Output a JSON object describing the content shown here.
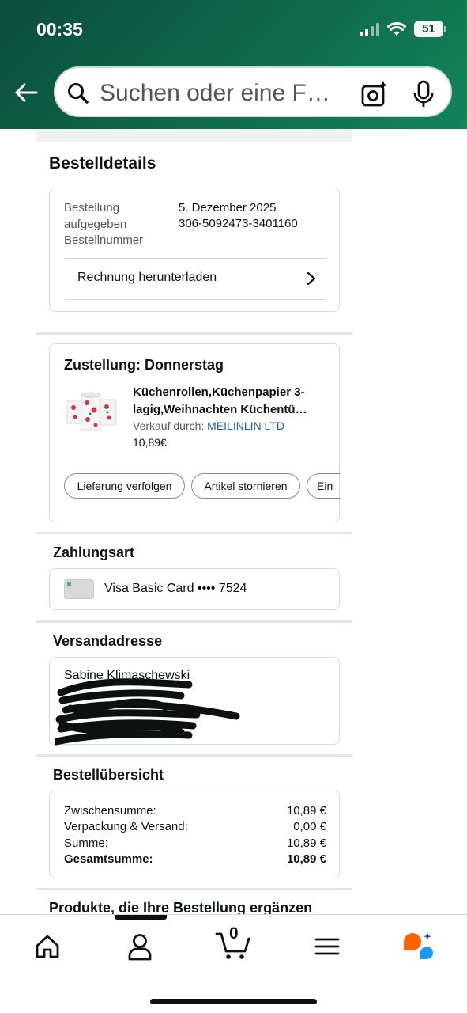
{
  "status_bar": {
    "time": "00:35",
    "battery": "51"
  },
  "search": {
    "placeholder": "Suchen oder eine F…"
  },
  "order_details": {
    "title": "Bestelldetails",
    "placed_label": "Bestellung aufgegeben",
    "placed_value": "5. Dezember 2025",
    "number_label": "Bestellnummer",
    "number_value": "306-5092473-3401160",
    "invoice_link": "Rechnung herunterladen"
  },
  "shipment": {
    "title": "Zustellung: Donnerstag",
    "product_name_line1": "Küchenrollen,Küchenpapier 3-",
    "product_name_line2": "lagig,Weihnachten Küchentü…",
    "sold_by_label": "Verkauf durch:",
    "seller": "MEILINLIN LTD",
    "price": "10,89€",
    "actions": [
      "Lieferung verfolgen",
      "Artikel stornieren",
      "Ein"
    ]
  },
  "payment": {
    "title": "Zahlungsart",
    "card": "Visa Basic Card •••• 7524"
  },
  "shipping_address": {
    "title": "Versandadresse",
    "name": "Sabine Klimaschewski"
  },
  "summary": {
    "title": "Bestellübersicht",
    "rows": [
      {
        "label": "Zwischensumme:",
        "value": "10,89 €"
      },
      {
        "label": "Verpackung & Versand:",
        "value": "0,00 €"
      },
      {
        "label": "Summe:",
        "value": "10,89 €"
      },
      {
        "label": "Gesamtsumme:",
        "value": "10,89 €"
      }
    ]
  },
  "related_heading": "Produkte, die Ihre Bestellung ergänzen",
  "bottom_nav": {
    "cart_count": "0"
  },
  "colors": {
    "header_green": "#0f6b4c",
    "link_blue": "#2162a1",
    "rufus_orange": "#ff6200",
    "rufus_blue": "#1a98ff"
  }
}
